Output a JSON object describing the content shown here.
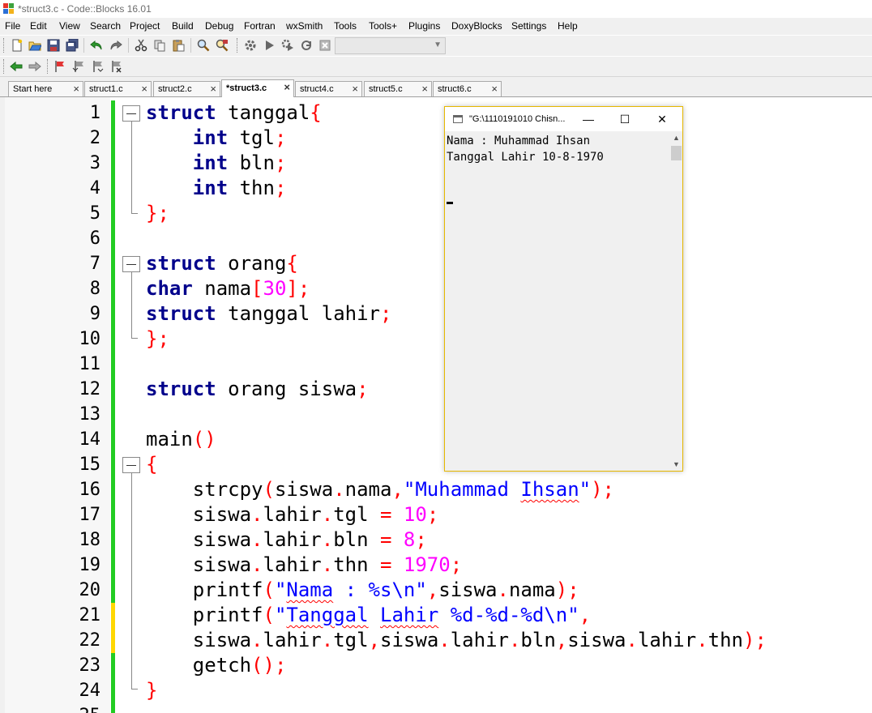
{
  "window": {
    "title": "*struct3.c - Code::Blocks 16.01"
  },
  "menu": [
    "File",
    "Edit",
    "View",
    "Search",
    "Project",
    "Build",
    "Debug",
    "Fortran",
    "wxSmith",
    "Tools",
    "Tools+",
    "Plugins",
    "DoxyBlocks",
    "Settings",
    "Help"
  ],
  "toolbar1": [
    "new-file-icon",
    "open-icon",
    "save-icon",
    "save-all-icon",
    "undo-icon",
    "redo-icon",
    "cut-icon",
    "copy-icon",
    "paste-icon",
    "find-icon",
    "replace-icon",
    "build-icon",
    "run-icon",
    "build-run-icon",
    "rebuild-icon",
    "abort-icon"
  ],
  "build_target_select": {
    "value": ""
  },
  "toolbar2": [
    "jump-back-icon",
    "jump-forward-icon",
    "toggle-bookmark-icon",
    "prev-bookmark-icon",
    "next-bookmark-icon",
    "clear-bookmarks-icon"
  ],
  "tabs": [
    {
      "label": "Start here",
      "active": false
    },
    {
      "label": "struct1.c",
      "active": false
    },
    {
      "label": "struct2.c",
      "active": false
    },
    {
      "label": "*struct3.c",
      "active": true
    },
    {
      "label": "struct4.c",
      "active": false
    },
    {
      "label": "struct5.c",
      "active": false
    },
    {
      "label": "struct6.c",
      "active": false
    }
  ],
  "editor": {
    "line_numbers": [
      "1",
      "2",
      "3",
      "4",
      "5",
      "6",
      "7",
      "8",
      "9",
      "10",
      "11",
      "12",
      "13",
      "14",
      "15",
      "16",
      "17",
      "18",
      "19",
      "20",
      "21",
      "22",
      "23",
      "24",
      "25"
    ],
    "lines": [
      [
        [
          "kw",
          "struct"
        ],
        [
          "tx",
          " tanggal"
        ],
        [
          "op",
          "{"
        ]
      ],
      [
        [
          "tx",
          "    "
        ],
        [
          "kw",
          "int"
        ],
        [
          "tx",
          " tgl"
        ],
        [
          "op",
          ";"
        ]
      ],
      [
        [
          "tx",
          "    "
        ],
        [
          "kw",
          "int"
        ],
        [
          "tx",
          " bln"
        ],
        [
          "op",
          ";"
        ]
      ],
      [
        [
          "tx",
          "    "
        ],
        [
          "kw",
          "int"
        ],
        [
          "tx",
          " thn"
        ],
        [
          "op",
          ";"
        ]
      ],
      [
        [
          "op",
          "};"
        ]
      ],
      [],
      [
        [
          "kw",
          "struct"
        ],
        [
          "tx",
          " orang"
        ],
        [
          "op",
          "{"
        ]
      ],
      [
        [
          "kw",
          "char"
        ],
        [
          "tx",
          " nama"
        ],
        [
          "op",
          "["
        ],
        [
          "nm",
          "30"
        ],
        [
          "op",
          "];"
        ]
      ],
      [
        [
          "kw",
          "struct"
        ],
        [
          "tx",
          " tanggal lahir"
        ],
        [
          "op",
          ";"
        ]
      ],
      [
        [
          "op",
          "};"
        ]
      ],
      [],
      [
        [
          "kw",
          "struct"
        ],
        [
          "tx",
          " orang siswa"
        ],
        [
          "op",
          ";"
        ]
      ],
      [],
      [
        [
          "tx",
          "main"
        ],
        [
          "op",
          "()"
        ]
      ],
      [
        [
          "op",
          "{"
        ]
      ],
      [
        [
          "tx",
          "    strcpy"
        ],
        [
          "op",
          "("
        ],
        [
          "tx",
          "siswa"
        ],
        [
          "op",
          "."
        ],
        [
          "tx",
          "nama"
        ],
        [
          "op",
          ","
        ],
        [
          "st",
          "\"Muhammad "
        ],
        [
          "st sq",
          "Ihsan"
        ],
        [
          "st",
          "\""
        ],
        [
          "op",
          ");"
        ]
      ],
      [
        [
          "tx",
          "    siswa"
        ],
        [
          "op",
          "."
        ],
        [
          "tx",
          "lahir"
        ],
        [
          "op",
          "."
        ],
        [
          "tx",
          "tgl "
        ],
        [
          "op",
          "="
        ],
        [
          "tx",
          " "
        ],
        [
          "nm",
          "10"
        ],
        [
          "op",
          ";"
        ]
      ],
      [
        [
          "tx",
          "    siswa"
        ],
        [
          "op",
          "."
        ],
        [
          "tx",
          "lahir"
        ],
        [
          "op",
          "."
        ],
        [
          "tx",
          "bln "
        ],
        [
          "op",
          "="
        ],
        [
          "tx",
          " "
        ],
        [
          "nm",
          "8"
        ],
        [
          "op",
          ";"
        ]
      ],
      [
        [
          "tx",
          "    siswa"
        ],
        [
          "op",
          "."
        ],
        [
          "tx",
          "lahir"
        ],
        [
          "op",
          "."
        ],
        [
          "tx",
          "thn "
        ],
        [
          "op",
          "="
        ],
        [
          "tx",
          " "
        ],
        [
          "nm",
          "1970"
        ],
        [
          "op",
          ";"
        ]
      ],
      [
        [
          "tx",
          "    printf"
        ],
        [
          "op",
          "("
        ],
        [
          "st",
          "\""
        ],
        [
          "st sq",
          "Nama"
        ],
        [
          "st",
          " : %s\\n\""
        ],
        [
          "op",
          ","
        ],
        [
          "tx",
          "siswa"
        ],
        [
          "op",
          "."
        ],
        [
          "tx",
          "nama"
        ],
        [
          "op",
          ");"
        ]
      ],
      [
        [
          "tx",
          "    printf"
        ],
        [
          "op",
          "("
        ],
        [
          "st",
          "\""
        ],
        [
          "st sq",
          "Tanggal"
        ],
        [
          "st",
          " "
        ],
        [
          "st sq",
          "Lahir"
        ],
        [
          "st",
          " %d-%d-%d\\n\""
        ],
        [
          "op",
          ","
        ]
      ],
      [
        [
          "tx",
          "    siswa"
        ],
        [
          "op",
          "."
        ],
        [
          "tx",
          "lahir"
        ],
        [
          "op",
          "."
        ],
        [
          "tx",
          "tgl"
        ],
        [
          "op",
          ","
        ],
        [
          "tx",
          "siswa"
        ],
        [
          "op",
          "."
        ],
        [
          "tx",
          "lahir"
        ],
        [
          "op",
          "."
        ],
        [
          "tx",
          "bln"
        ],
        [
          "op",
          ","
        ],
        [
          "tx",
          "siswa"
        ],
        [
          "op",
          "."
        ],
        [
          "tx",
          "lahir"
        ],
        [
          "op",
          "."
        ],
        [
          "tx",
          "thn"
        ],
        [
          "op",
          ");"
        ]
      ],
      [
        [
          "tx",
          "    getch"
        ],
        [
          "op",
          "();"
        ]
      ],
      [
        [
          "op",
          "}"
        ]
      ],
      []
    ],
    "change_marks": [
      "saved",
      "saved",
      "saved",
      "saved",
      "saved",
      "saved",
      "saved",
      "saved",
      "saved",
      "saved",
      "saved",
      "saved",
      "saved",
      "saved",
      "saved",
      "saved",
      "saved",
      "saved",
      "saved",
      "saved",
      "modified",
      "modified",
      "saved",
      "saved",
      "saved"
    ],
    "colors": {
      "saved": "#22cc22",
      "modified": "#ffd700"
    }
  },
  "console": {
    "title": "\"G:\\1110191010 Chisn...",
    "output": [
      "Nama : Muhammad Ihsan",
      "Tanggal Lahir 10-8-1970"
    ],
    "buttons": {
      "minimize": "—",
      "maximize": "☐",
      "close": "✕"
    }
  }
}
